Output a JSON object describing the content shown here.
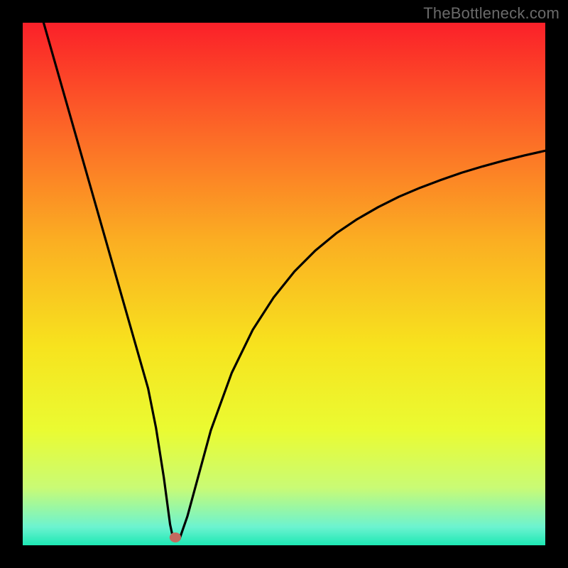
{
  "watermark": "TheBottleneck.com",
  "chart_data": {
    "type": "line",
    "title": "",
    "xlabel": "",
    "ylabel": "",
    "xlim": [
      0,
      100
    ],
    "ylim": [
      0,
      100
    ],
    "grid": false,
    "legend": false,
    "series": [
      {
        "name": "bottleneck-curve",
        "mode": "line",
        "color": "#000000",
        "x": [
          4,
          6,
          8,
          10,
          12,
          14,
          16,
          18,
          20,
          22,
          24,
          25.5,
          27,
          28.2,
          28.8,
          30,
          31.5,
          33,
          36,
          40,
          44,
          48,
          52,
          56,
          60,
          64,
          68,
          72,
          76,
          80,
          84,
          88,
          92,
          96,
          100
        ],
        "y": [
          100,
          93,
          86,
          79,
          72,
          65,
          58,
          51,
          44,
          37,
          30,
          22.5,
          13,
          4,
          1.2,
          1.2,
          5.5,
          11,
          22,
          33,
          41.2,
          47.4,
          52.4,
          56.4,
          59.7,
          62.4,
          64.7,
          66.7,
          68.4,
          69.9,
          71.3,
          72.5,
          73.6,
          74.6,
          75.5
        ]
      }
    ],
    "marker": {
      "name": "optimal-point",
      "x": 29.2,
      "y": 1.5,
      "rx": 1.1,
      "ry": 0.95,
      "fill": "#c46a5f"
    },
    "background_gradient": {
      "direction": "top-to-bottom",
      "stops": [
        {
          "offset": 0.0,
          "color": "#fb2029"
        },
        {
          "offset": 0.22,
          "color": "#fc6c27"
        },
        {
          "offset": 0.42,
          "color": "#fbaf22"
        },
        {
          "offset": 0.62,
          "color": "#f7e31e"
        },
        {
          "offset": 0.78,
          "color": "#eafb32"
        },
        {
          "offset": 0.89,
          "color": "#c9fb75"
        },
        {
          "offset": 0.965,
          "color": "#6cf3d0"
        },
        {
          "offset": 1.0,
          "color": "#1de8b4"
        }
      ]
    }
  }
}
